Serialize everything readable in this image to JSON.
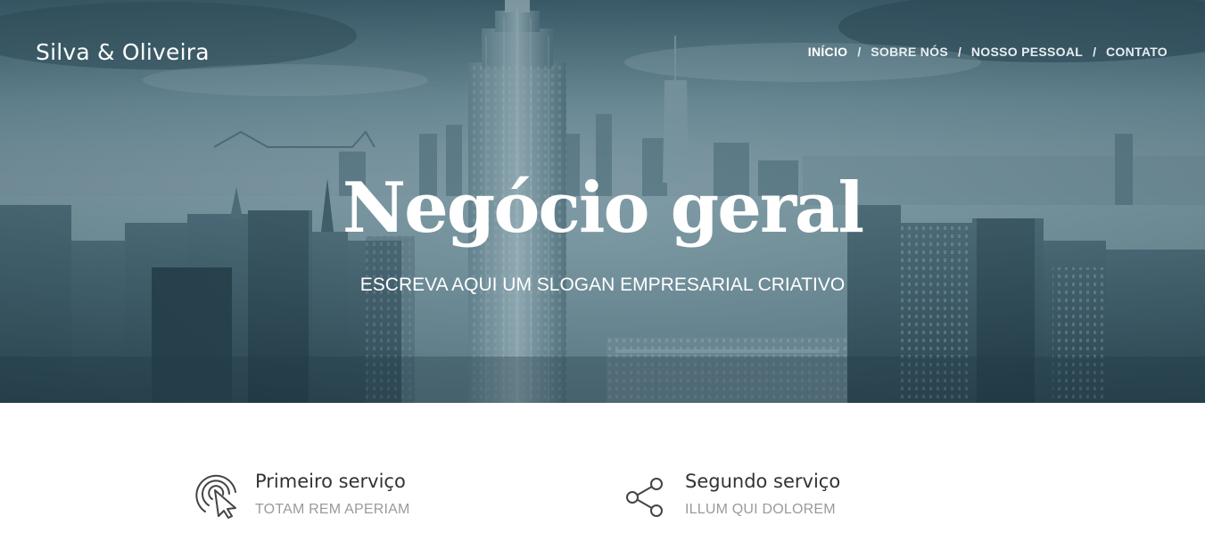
{
  "header": {
    "brand": "Silva & Oliveira",
    "nav": [
      {
        "label": "INÍCIO",
        "active": true
      },
      {
        "label": "SOBRE NÓS",
        "active": false
      },
      {
        "label": "NOSSO PESSOAL",
        "active": false
      },
      {
        "label": "CONTATO",
        "active": false
      }
    ],
    "separator": "/"
  },
  "hero": {
    "title": "Negócio geral",
    "slogan": "ESCREVA AQUI UM SLOGAN EMPRESARIAL CRIATIVO",
    "background": "city-skyline-photo"
  },
  "services": [
    {
      "title": "Primeiro serviço",
      "subtitle": "TOTAM REM APERIAM",
      "icon": "click-pointer-icon"
    },
    {
      "title": "Segundo serviço",
      "subtitle": "ILLUM QUI DOLOREM",
      "icon": "share-icon"
    }
  ],
  "colors": {
    "hero_tint": "#3f6170",
    "title_text": "#333333",
    "subtitle_text": "#9a9a9a",
    "icon_stroke": "#444444"
  }
}
